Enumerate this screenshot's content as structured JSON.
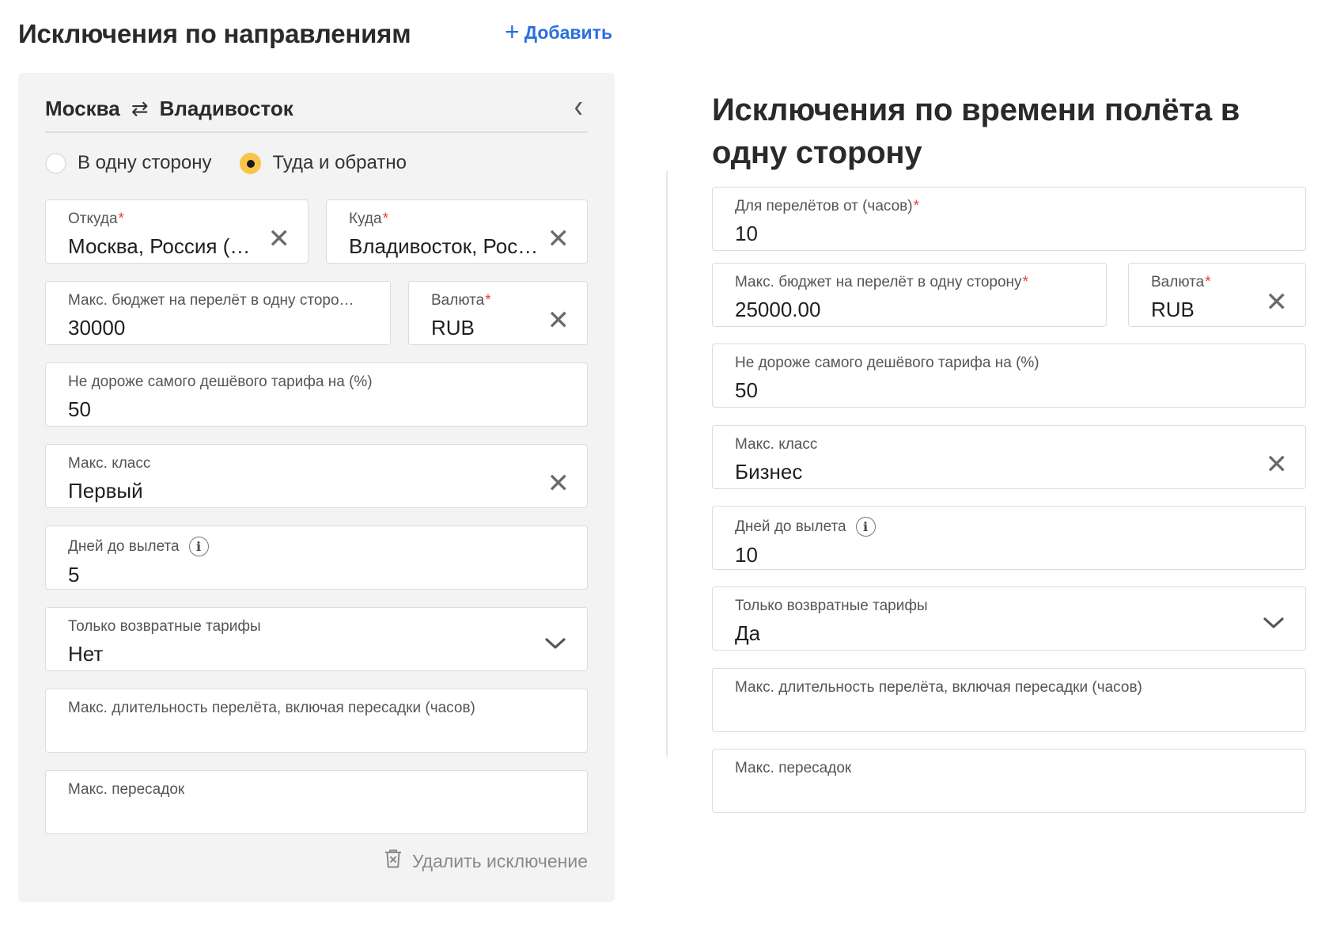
{
  "left": {
    "title": "Исключения по направлениям",
    "add_label": "Добавить",
    "card": {
      "from_city": "Москва",
      "to_city": "Владивосток",
      "trip_type": {
        "one_way": "В одну сторону",
        "round_trip": "Туда и обратно",
        "selected": "round_trip"
      },
      "from_field": {
        "label": "Откуда",
        "value": "Москва, Россия (…"
      },
      "to_field": {
        "label": "Куда",
        "value": "Владивосток, Рос…"
      },
      "budget_field": {
        "label": "Макс. бюджет на перелёт в одну сторо…",
        "value": "30000"
      },
      "currency_field": {
        "label": "Валюта",
        "value": "RUB"
      },
      "cheapest_field": {
        "label": "Не дороже самого дешёвого тарифа на (%)",
        "value": "50"
      },
      "class_field": {
        "label": "Макс. класс",
        "value": "Первый"
      },
      "days_field": {
        "label": "Дней до вылета",
        "value": "5"
      },
      "refundable_field": {
        "label": "Только возвратные тарифы",
        "value": "Нет"
      },
      "duration_field": {
        "label": "Макс. длительность перелёта, включая пересадки (часов)",
        "value": ""
      },
      "transfers_field": {
        "label": "Макс. пересадок",
        "value": ""
      },
      "delete_label": "Удалить исключение"
    }
  },
  "right": {
    "title": "Исключения по времени полёта в одну сторону",
    "flight_hours_field": {
      "label": "Для перелётов от (часов)",
      "value": "10"
    },
    "budget_field": {
      "label": "Макс. бюджет на перелёт в одну сторону",
      "value": "25000.00"
    },
    "currency_field": {
      "label": "Валюта",
      "value": "RUB"
    },
    "cheapest_field": {
      "label": "Не дороже самого дешёвого тарифа на (%)",
      "value": "50"
    },
    "class_field": {
      "label": "Макс. класс",
      "value": "Бизнес"
    },
    "days_field": {
      "label": "Дней до вылета",
      "value": "10"
    },
    "refundable_field": {
      "label": "Только возвратные тарифы",
      "value": "Да"
    },
    "duration_field": {
      "label": "Макс. длительность перелёта, включая пересадки (часов)",
      "value": ""
    },
    "transfers_field": {
      "label": "Макс. пересадок",
      "value": ""
    }
  },
  "colors": {
    "accent_link": "#2b6fe0",
    "radio_selected": "#f7c649",
    "required_mark": "#e04343",
    "card_background": "#f3f3f3"
  },
  "icons": [
    "plus-icon",
    "swap-arrows-icon",
    "chevron-left-icon",
    "close-icon",
    "chevron-down-icon",
    "info-icon",
    "trash-icon"
  ]
}
